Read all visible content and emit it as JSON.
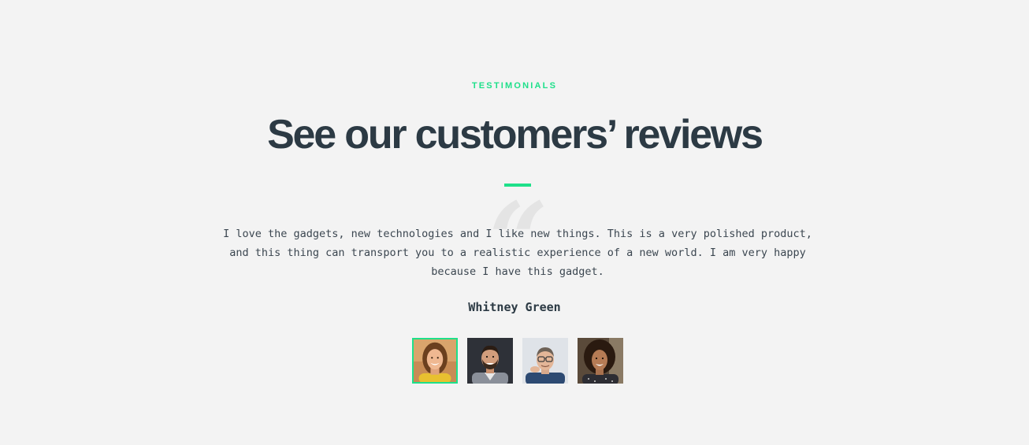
{
  "section": {
    "eyebrow": "TESTIMONIALS",
    "title": "See our customers’ reviews"
  },
  "testimonial": {
    "quote_icon": "quote-icon",
    "text": "I love the gadgets, new technologies and I like new things. This is a very polished product, and this thing can transport you to a realistic experience of a new world. I am very happy because I have this gadget.",
    "author": "Whitney Green"
  },
  "avatars": [
    {
      "name": "customer-avatar-1",
      "active": true
    },
    {
      "name": "customer-avatar-2",
      "active": false
    },
    {
      "name": "customer-avatar-3",
      "active": false
    },
    {
      "name": "customer-avatar-4",
      "active": false
    }
  ],
  "colors": {
    "accent": "#1ee08a",
    "heading": "#2c3a44",
    "background": "#f3f3f3"
  }
}
